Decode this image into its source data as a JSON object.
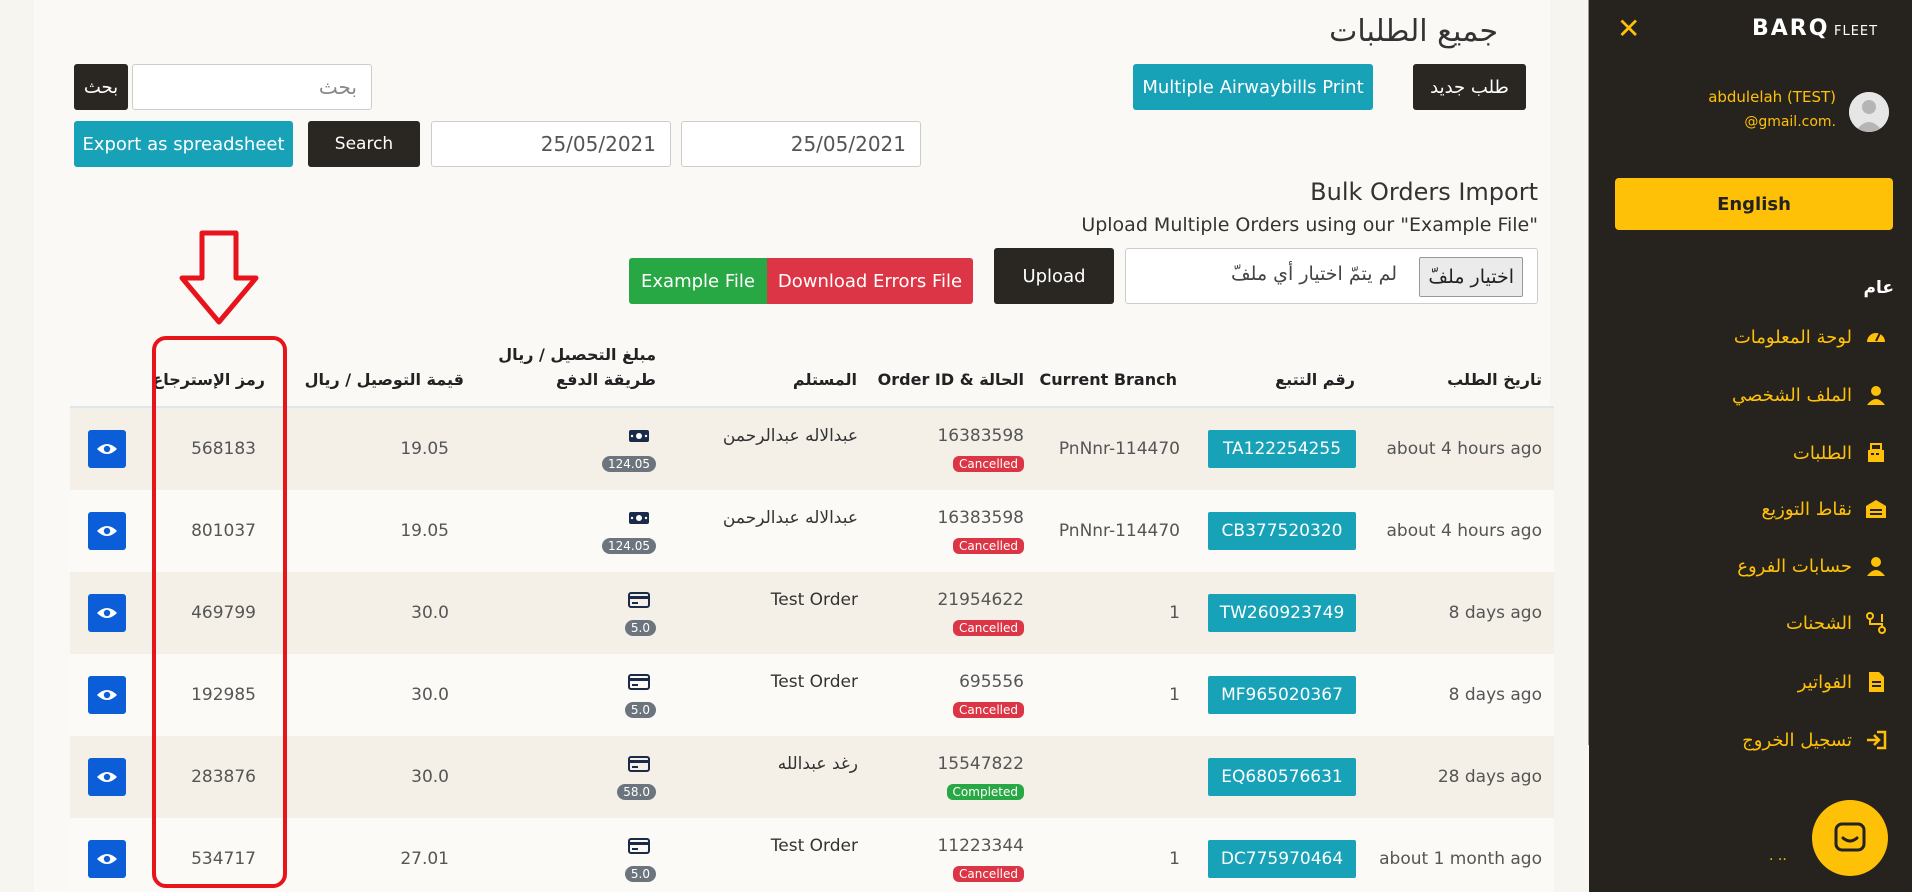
{
  "page": {
    "title": "جميع الطلبات"
  },
  "toolbar": {
    "new_order": "طلب جديد",
    "multi_print": "Multiple Airwaybills Print",
    "search_btn_ar": "بحث",
    "search_placeholder": "بحث",
    "date_from": "25/05/2021",
    "date_to": "25/05/2021",
    "search_btn": "Search",
    "export_btn": "Export as spreadsheet"
  },
  "bulk": {
    "title": "Bulk Orders Import",
    "desc": "Upload Multiple Orders using our \"Example File\"",
    "choose_file": "اختيار ملفّ",
    "no_file": "لم يتمّ اختيار أي ملفّ",
    "upload": "Upload",
    "errors_file": "Download Errors File",
    "example_file": "Example File"
  },
  "table": {
    "headers": {
      "date": "تاريخ الطلب",
      "tracking": "رقم التتبع",
      "branch": "Current Branch",
      "order": "Order ID & الحالة",
      "recipient": "المستلم",
      "collect_line1": "مبلغ التحصيل / ريال",
      "collect_line2": "طريقة الدفع",
      "delivery": "قيمة التوصيل / ريال",
      "return_code": "رمز الإسترجاع"
    },
    "rows": [
      {
        "date": "about 4 hours ago",
        "tracking": "TA122254255",
        "branch": "PnNnr-114470",
        "order_id": "16383598",
        "status": "Cancelled",
        "recipient": "عبدالاله عبدالرحمن",
        "pay_method": "cash-icon",
        "collect": "124.05",
        "delivery": "19.05",
        "return_code": "568183"
      },
      {
        "date": "about 4 hours ago",
        "tracking": "CB377520320",
        "branch": "PnNnr-114470",
        "order_id": "16383598",
        "status": "Cancelled",
        "recipient": "عبدالاله عبدالرحمن",
        "pay_method": "cash-icon",
        "collect": "124.05",
        "delivery": "19.05",
        "return_code": "801037"
      },
      {
        "date": "8 days ago",
        "tracking": "TW260923749",
        "branch": "1",
        "order_id": "21954622",
        "status": "Cancelled",
        "recipient": "Test Order",
        "pay_method": "card-icon",
        "collect": "5.0",
        "delivery": "30.0",
        "return_code": "469799"
      },
      {
        "date": "8 days ago",
        "tracking": "MF965020367",
        "branch": "1",
        "order_id": "695556",
        "status": "Cancelled",
        "recipient": "Test Order",
        "pay_method": "card-icon",
        "collect": "5.0",
        "delivery": "30.0",
        "return_code": "192985"
      },
      {
        "date": "28 days ago",
        "tracking": "EQ680576631",
        "branch": "",
        "order_id": "15547822",
        "status": "Completed",
        "recipient": "رغد عبدالله",
        "pay_method": "card-icon",
        "collect": "58.0",
        "delivery": "30.0",
        "return_code": "283876"
      },
      {
        "date": "about 1 month ago",
        "tracking": "DC775970464",
        "branch": "1",
        "order_id": "11223344",
        "status": "Cancelled",
        "recipient": "Test Order",
        "pay_method": "card-icon",
        "collect": "5.0",
        "delivery": "27.01",
        "return_code": "534717"
      }
    ]
  },
  "sidebar": {
    "logo": "BARQ",
    "logo_sub": "FLEET",
    "user_name": "abdulelah (TEST)",
    "user_email": "@gmail.com.",
    "lang_btn": "English",
    "section": "عام",
    "items": [
      {
        "label": "لوحة المعلومات",
        "icon": "dashboard-icon"
      },
      {
        "label": "الملف الشخصي",
        "icon": "user-icon"
      },
      {
        "label": "الطلبات",
        "icon": "orders-icon"
      },
      {
        "label": "نقاط التوزيع",
        "icon": "warehouse-icon"
      },
      {
        "label": "حسابات الفروع",
        "icon": "branch-user-icon"
      },
      {
        "label": "الشحنات",
        "icon": "shipments-icon"
      },
      {
        "label": "الفواتير",
        "icon": "invoice-icon"
      },
      {
        "label": "تسجيل الخروج",
        "icon": "logout-icon"
      }
    ],
    "dots": "· ··"
  },
  "colors": {
    "accent": "#ffc107",
    "teal": "#17a2b8",
    "dark": "#2a2723",
    "danger": "#dc3545",
    "success": "#28a745",
    "highlight": "#e8141c"
  }
}
